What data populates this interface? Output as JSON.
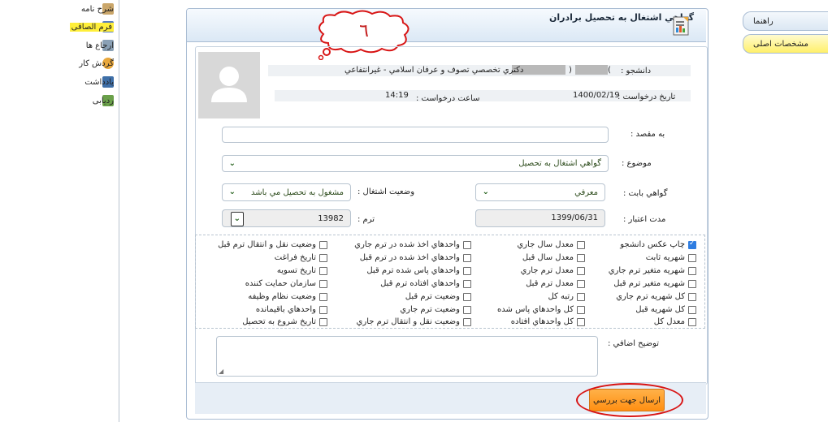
{
  "sidebar": {
    "items": [
      {
        "label": "شرح نامه",
        "icon": "letter-icon",
        "color": "#caa66a"
      },
      {
        "label": "فرم الصاقی",
        "icon": "form-icon",
        "color": "#5a7ec0"
      },
      {
        "label": "ارجاع ها",
        "icon": "refer-icon",
        "color": "#8aa0b5"
      },
      {
        "label": "گردش کار",
        "icon": "workflow-icon",
        "color": "#e8a73c"
      },
      {
        "label": "يادداشت",
        "icon": "note-icon",
        "color": "#3e6fa8"
      },
      {
        "label": "ردیابی",
        "icon": "tracking-icon",
        "color": "#6aa04a"
      }
    ]
  },
  "tabs": {
    "guide": "راهنما",
    "main": "مشخصات اصلی"
  },
  "header": {
    "title": "گواهي اشتغال به تحصيل برادران"
  },
  "annotation": {
    "number": "٦"
  },
  "info": {
    "student_label": "دانشجو :",
    "student_paren": "(",
    "student_paren_close": ")",
    "student_program": "دکتري تخصصي تصوف و عرفان اسلامي - غيرانتفاعي",
    "request_date_label": "تاريخ درخواست :",
    "request_date": "1400/02/19",
    "request_time_label": "ساعت درخواست :",
    "request_time": "14:19"
  },
  "form": {
    "destination_label": "به مقصد :",
    "destination_value": "",
    "subject_label": "موضوع :",
    "subject_value": "گواهي اشتغال به تحصيل",
    "certificate_label": "گواهي بابت :",
    "certificate_value": "معرفي",
    "employment_label": "وضعيت اشتغال :",
    "employment_value": "مشغول به تحصيل مي باشد",
    "validity_label": "مدت اعتبار :",
    "validity_value": "1399/06/31",
    "term_label": "ترم :",
    "term_value": "13982",
    "extra_label": "توضيح اضافي :",
    "extra_value": ""
  },
  "checkboxes": {
    "col1": [
      {
        "label": "چاپ عکس دانشجو",
        "checked": true
      },
      {
        "label": "شهريه ثابت",
        "checked": false
      },
      {
        "label": "شهريه متغير ترم جاري",
        "checked": false
      },
      {
        "label": "شهريه متغير ترم قبل",
        "checked": false
      },
      {
        "label": "کل شهريه ترم جاري",
        "checked": false
      },
      {
        "label": "کل شهريه قبل",
        "checked": false
      },
      {
        "label": "معدل کل",
        "checked": false
      }
    ],
    "col2": [
      {
        "label": "معدل سال جاري",
        "checked": false
      },
      {
        "label": "معدل سال قبل",
        "checked": false
      },
      {
        "label": "معدل ترم جاري",
        "checked": false
      },
      {
        "label": "معدل ترم قبل",
        "checked": false
      },
      {
        "label": "رتبه کل",
        "checked": false
      },
      {
        "label": "کل واحدهاي پاس شده",
        "checked": false
      },
      {
        "label": "کل واحدهاي افتاده",
        "checked": false
      }
    ],
    "col3": [
      {
        "label": "واحدهاي اخذ شده در ترم جاري",
        "checked": false
      },
      {
        "label": "واحدهاي اخذ شده در ترم قبل",
        "checked": false
      },
      {
        "label": "واحدهاي پاس شده ترم قبل",
        "checked": false
      },
      {
        "label": "واحدهاي افتاده ترم قبل",
        "checked": false
      },
      {
        "label": "وضعيت ترم قبل",
        "checked": false
      },
      {
        "label": "وضعيت ترم جاري",
        "checked": false
      },
      {
        "label": "وضعيت نقل و انتقال ترم جاري",
        "checked": false
      }
    ],
    "col4": [
      {
        "label": "وضعيت نقل و انتقال ترم قبل",
        "checked": false
      },
      {
        "label": "تاريخ فراغت",
        "checked": false
      },
      {
        "label": "تاريخ تسويه",
        "checked": false
      },
      {
        "label": "سازمان حمايت کننده",
        "checked": false
      },
      {
        "label": "وضعيت نظام وظيفه",
        "checked": false
      },
      {
        "label": "واحدهاي باقيمانده",
        "checked": false
      },
      {
        "label": "تاريخ شروع به تحصيل",
        "checked": false
      }
    ]
  },
  "submit": {
    "label": "ارسال جهت بررسي"
  },
  "colors": {
    "accent": "#ff9a22",
    "highlight": "#ffef3a",
    "annotation_red": "#d81515"
  }
}
